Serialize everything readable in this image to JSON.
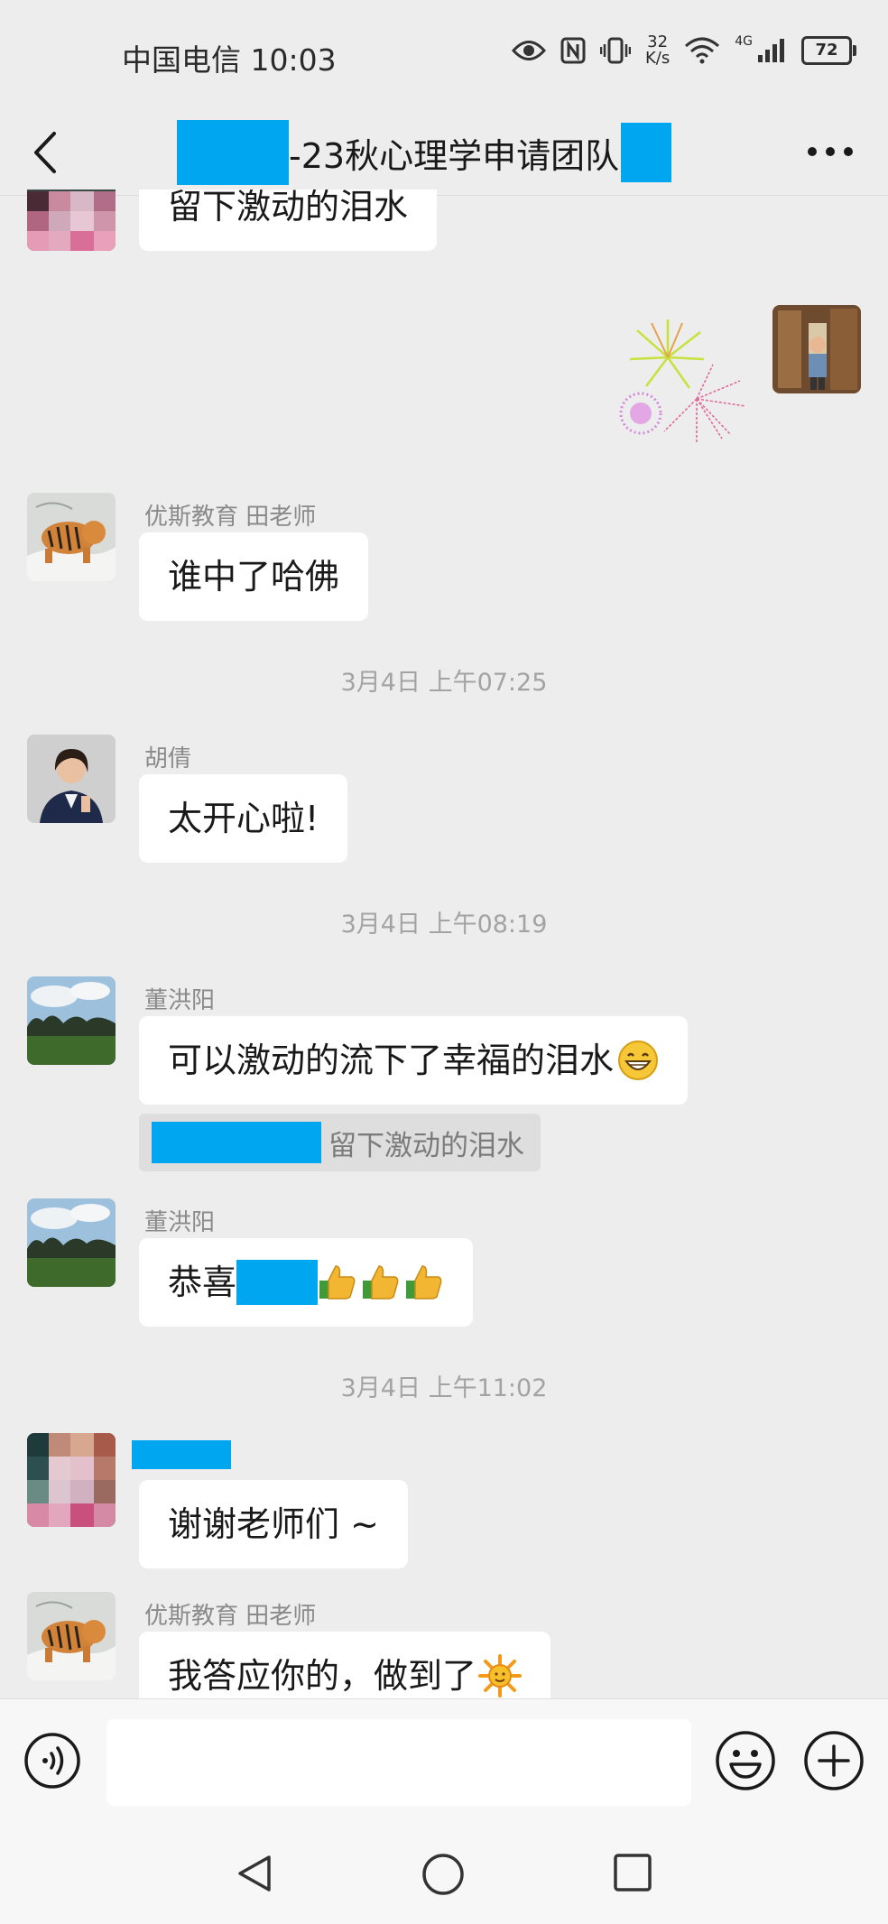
{
  "status_bar": {
    "carrier_time": "中国电信 10:03",
    "speed_top": "32",
    "speed_bottom": "K/s",
    "network": "4G",
    "battery": "72"
  },
  "header": {
    "title": "-23秋心理学申请团队",
    "back_icon": "chevron-left-icon",
    "more_icon": "more-dots-icon"
  },
  "messages": {
    "m0": {
      "text": "留下激动的泪水"
    },
    "m1": {
      "sender": "优斯教育 田老师",
      "text": "谁中了哈佛"
    },
    "t1": "3月4日 上午07:25",
    "m2": {
      "sender": "胡倩",
      "text": "太开心啦!"
    },
    "t2": "3月4日 上午08:19",
    "m3": {
      "sender": "董洪阳",
      "text": "可以激动的流下了幸福的泪水",
      "quote": "留下激动的泪水"
    },
    "m4": {
      "sender": "董洪阳",
      "text_prefix": "恭喜"
    },
    "t3": "3月4日 上午11:02",
    "m5": {
      "text": "谢谢老师们 ~"
    },
    "m6": {
      "sender": "优斯教育 田老师",
      "text": "我答应你的，做到了"
    }
  },
  "input_bar": {
    "voice_icon": "voice-icon",
    "emoji_icon": "emoji-icon",
    "plus_icon": "plus-icon"
  },
  "colors": {
    "background": "#ededed",
    "bubble": "#ffffff",
    "redaction": "#00a6f0"
  }
}
